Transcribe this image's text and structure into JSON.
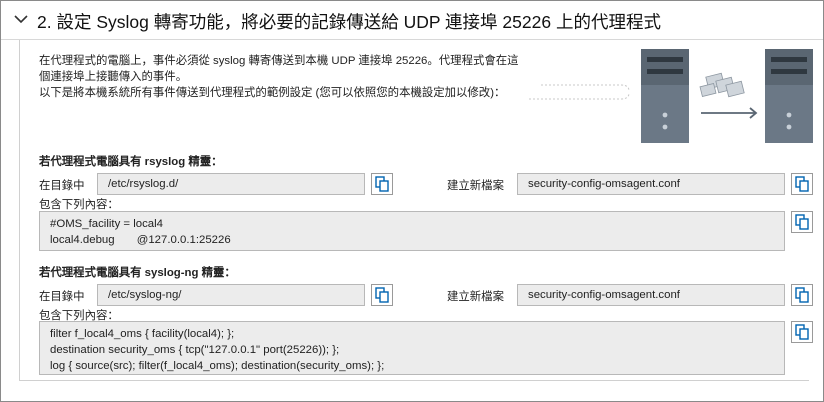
{
  "header": {
    "title": "2. 設定 Syslog 轉寄功能，將必要的記錄傳送給 UDP 連接埠 25226 上的代理程式"
  },
  "description": {
    "line1": "在代理程式的電腦上，事件必須從 syslog 轉寄傳送到本機 UDP 連接埠 25226。代理程式會在這個連接埠上接聽傳入的事件。",
    "line2": "以下是將本機系統所有事件傳送到代理程式的範例設定 (您可以依照您的本機設定加以修改)："
  },
  "rsyslog": {
    "heading": "若代理程式電腦具有 rsyslog 精靈：",
    "dir_label": "在目錄中",
    "dir_value": "/etc/rsyslog.d/",
    "file_label": "建立新檔案",
    "file_value": "security-config-omsagent.conf",
    "content_label": "包含下列內容：",
    "content_lines": [
      "#OMS_facility = local4",
      "local4.debug       @127.0.0.1:25226"
    ]
  },
  "syslogng": {
    "heading": "若代理程式電腦具有 syslog-ng 精靈：",
    "dir_label": "在目錄中",
    "dir_value": "/etc/syslog-ng/",
    "file_label": "建立新檔案",
    "file_value": "security-config-omsagent.conf",
    "content_label": "包含下列內容：",
    "content_lines": [
      "filter f_local4_oms { facility(local4); };",
      "destination security_oms { tcp(\"127.0.0.1\" port(25226)); };",
      "log { source(src); filter(f_local4_oms); destination(security_oms); };"
    ]
  },
  "icons": {
    "expand": "chevron-down-icon",
    "copy": "copy-icon",
    "server": "server-icon",
    "documents": "documents-icon",
    "arrow": "arrow-right-icon"
  },
  "colors": {
    "accent": "#0063b1",
    "server_dark": "#5f6e7c",
    "server_light": "#9aa6b1"
  }
}
